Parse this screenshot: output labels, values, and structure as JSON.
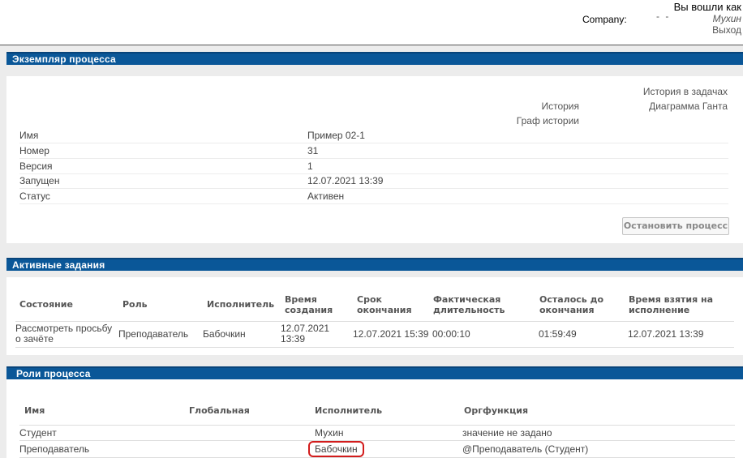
{
  "header": {
    "company_label": "Company:",
    "company_value": "- -",
    "logged_in_as": "Вы вошли как",
    "user_name": "Мухин",
    "logout": "Выход"
  },
  "process_instance": {
    "title": "Экземпляр процесса",
    "links": {
      "history_in_tasks": "История в задачах",
      "gantt": "Диаграмма Ганта",
      "history": "История",
      "history_graph": "Граф истории"
    },
    "properties": [
      {
        "label": "Имя",
        "value": "Пример 02-1"
      },
      {
        "label": "Номер",
        "value": "31"
      },
      {
        "label": "Версия",
        "value": "1"
      },
      {
        "label": "Запущен",
        "value": "12.07.2021 13:39"
      },
      {
        "label": "Статус",
        "value": "Активен"
      }
    ],
    "stop_button": "Остановить процесс"
  },
  "active_tasks": {
    "title": "Активные задания",
    "columns": [
      "Состояние",
      "Роль",
      "Исполнитель",
      "Время создания",
      "Срок окончания",
      "Фактическая длительность",
      "Осталось до окончания",
      "Время взятия на исполнение"
    ],
    "rows": [
      {
        "state": "Рассмотреть просьбу о зачёте",
        "role": "Преподаватель",
        "executor": "Бабочкин",
        "created": "12.07.2021 13:39",
        "deadline": "12.07.2021 15:39",
        "duration": "00:00:10",
        "remaining": "01:59:49",
        "taken": "12.07.2021 13:39"
      }
    ]
  },
  "process_roles": {
    "title": "Роли процесса",
    "columns": [
      "Имя",
      "Глобальная",
      "Исполнитель",
      "Оргфункция"
    ],
    "rows": [
      {
        "name": "Студент",
        "global": "",
        "executor": "Мухин",
        "orgfunction": "значение не задано"
      },
      {
        "name": "Преподаватель",
        "global": "",
        "executor": "Бабочкин",
        "orgfunction": "@Преподаватель (Студент)"
      }
    ]
  }
}
